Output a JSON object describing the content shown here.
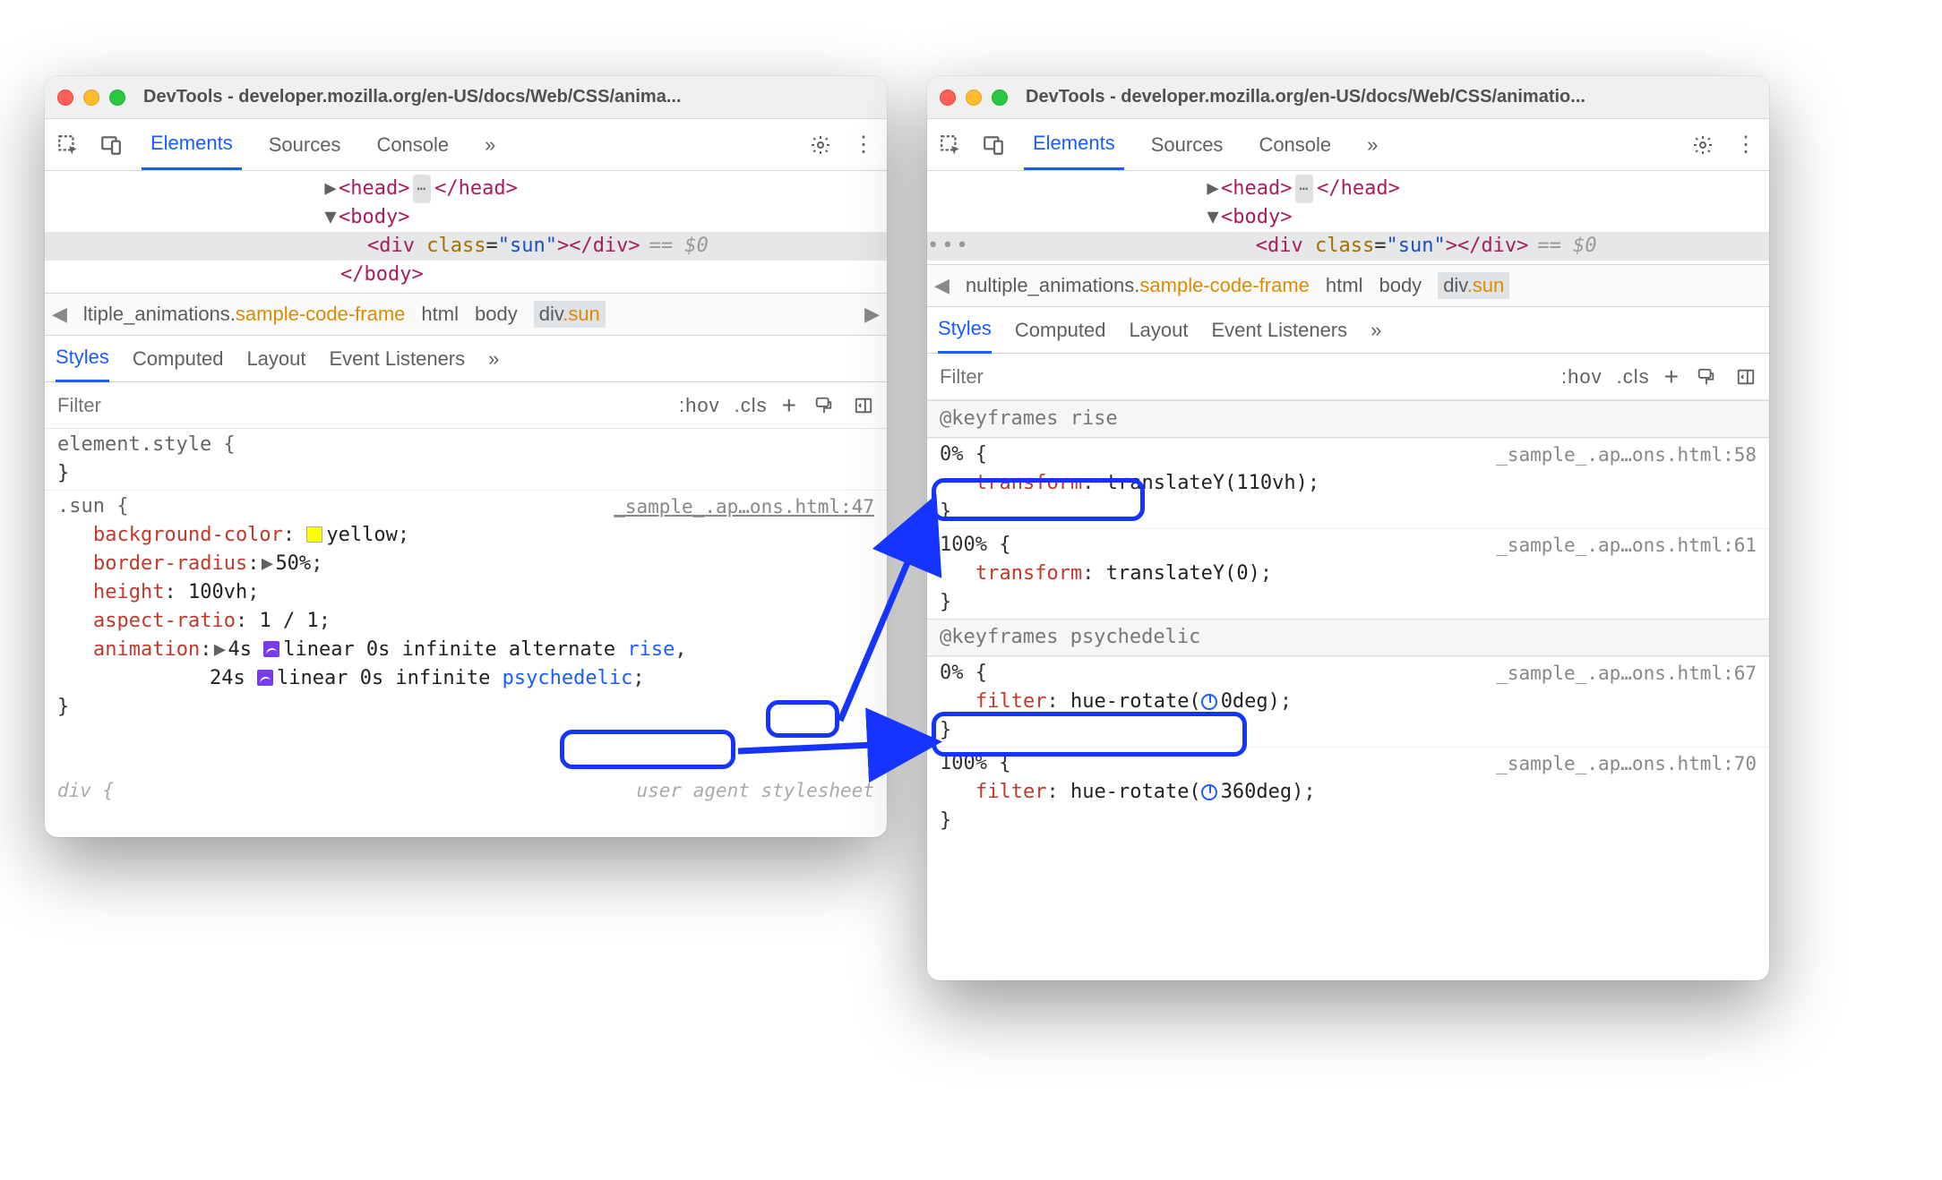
{
  "left": {
    "title": "DevTools - developer.mozilla.org/en-US/docs/Web/CSS/anima...",
    "tabs": {
      "elements": "Elements",
      "sources": "Sources",
      "console": "Console",
      "more": "»"
    },
    "dom": {
      "head_open": "<head>",
      "head_close": "</head>",
      "body_open": "<body>",
      "body_close": "</body>",
      "div_open": "<div",
      "div_class_attr": "class",
      "div_class_val": "\"sun\"",
      "div_close": "></div>",
      "marker": "== $0"
    },
    "breadcrumb": {
      "left_chev": "◀",
      "right_chev": "▶",
      "first_prefix": "ltiple_animations.",
      "first_suffix": "sample-code-frame",
      "html": "html",
      "body": "body",
      "divsun": "div.sun"
    },
    "subtabs": {
      "styles": "Styles",
      "computed": "Computed",
      "layout": "Layout",
      "listeners": "Event Listeners",
      "more": "»"
    },
    "filter": {
      "placeholder": "Filter",
      "hov": ":hov",
      "cls": ".cls",
      "plus": "+"
    },
    "styles": {
      "element_style": "element.style {",
      "sun_selector": ".sun {",
      "sun_source": "_sample_.ap…ons.html:47",
      "props": {
        "bgc_name": "background-color",
        "bgc_val": "yellow",
        "br_name": "border-radius",
        "br_val": "50%",
        "h_name": "height",
        "h_val": "100vh",
        "ar_name": "aspect-ratio",
        "ar_val": "1 / 1",
        "anim_name": "animation",
        "anim_line1_a": "4s ",
        "anim_line1_b": "linear 0s infinite alternate ",
        "anim_rise": "rise",
        "anim_line2_a": "24s ",
        "anim_line2_b": "linear 0s infinite ",
        "anim_psych": "psychedelic"
      },
      "close_brace": "}",
      "faded_left": "div {",
      "faded_right": "user agent stylesheet"
    }
  },
  "right": {
    "title": "DevTools - developer.mozilla.org/en-US/docs/Web/CSS/animatio...",
    "tabs": {
      "elements": "Elements",
      "sources": "Sources",
      "console": "Console",
      "more": "»"
    },
    "dom": {
      "head_open": "<head>",
      "head_close": "</head>",
      "body_open": "<body>",
      "div_open": "<div",
      "div_class_attr": "class",
      "div_class_val": "\"sun\"",
      "div_close": "></div>",
      "marker": "== $0"
    },
    "breadcrumb": {
      "left_chev": "◀",
      "first_prefix": "nultiple_animations.",
      "first_suffix": "sample-code-frame",
      "html": "html",
      "body": "body",
      "divsun": "div.sun"
    },
    "subtabs": {
      "styles": "Styles",
      "computed": "Computed",
      "layout": "Layout",
      "listeners": "Event Listeners",
      "more": "»"
    },
    "filter": {
      "placeholder": "Filter",
      "hov": ":hov",
      "cls": ".cls",
      "plus": "+"
    },
    "styles": {
      "kf_rise": "@keyframes rise",
      "rise_0_src": "_sample_.ap…ons.html:58",
      "rise_0_pct": "0% {",
      "rise_0_prop": "transform",
      "rise_0_val": "translateY(110vh)",
      "rise_100_src": "_sample_.ap…ons.html:61",
      "rise_100_pct": "100% {",
      "rise_100_prop": "transform",
      "rise_100_val": "translateY(0)",
      "kf_psych": "@keyframes psychedelic",
      "psych_0_src": "_sample_.ap…ons.html:67",
      "psych_0_pct": "0% {",
      "psych_0_prop": "filter",
      "psych_0_val_a": "hue-rotate(",
      "psych_0_val_b": "0deg)",
      "psych_100_src": "_sample_.ap…ons.html:70",
      "psych_100_pct": "100% {",
      "psych_100_prop": "filter",
      "psych_100_val_a": "hue-rotate(",
      "psych_100_val_b": "360deg)",
      "close_brace": "}"
    }
  }
}
